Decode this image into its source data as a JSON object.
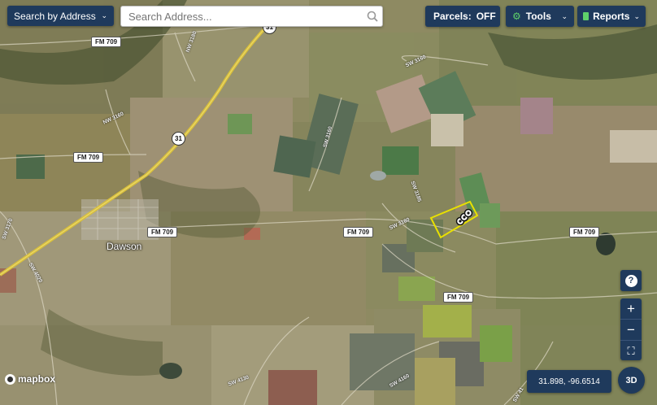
{
  "top_bar": {
    "search_mode_label": "Search by Address",
    "search_placeholder": "Search Address...",
    "parcels_label": "Parcels:",
    "parcels_state": "OFF",
    "tools_label": "Tools",
    "reports_label": "Reports"
  },
  "map": {
    "road_labels": [
      {
        "id": "fm709-a",
        "text": "FM 709"
      },
      {
        "id": "fm709-b",
        "text": "FM 709"
      },
      {
        "id": "fm709-c",
        "text": "FM 709"
      },
      {
        "id": "fm709-d",
        "text": "FM 709"
      },
      {
        "id": "fm709-e",
        "text": "FM 709"
      },
      {
        "id": "fm709-f",
        "text": "FM 709"
      }
    ],
    "minor_road_labels": [
      "NW 3180",
      "NW 3160",
      "SW 3160",
      "SW 3160",
      "SW 3180",
      "SW 3185",
      "SW 3170",
      "SW 4020",
      "SW 4130",
      "SW 4160",
      "SW 41"
    ],
    "shields": [
      "31",
      "31"
    ],
    "town_label": "Dawson",
    "brand": "mapbox"
  },
  "controls": {
    "help_symbol": "?",
    "zoom_in_symbol": "+",
    "zoom_out_symbol": "−",
    "fullscreen_symbol": "⛶",
    "coordinates": "31.898, -96.6514",
    "three_d_label": "3D"
  },
  "colors": {
    "control_bg": "#1f3a5c",
    "parcel_outline": "#e8e000",
    "highway": "#d9c03a"
  }
}
